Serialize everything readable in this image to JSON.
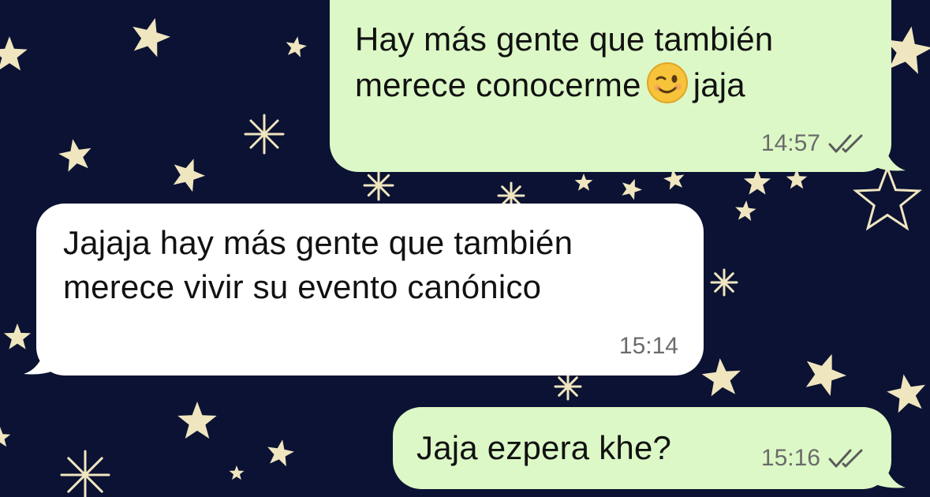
{
  "colors": {
    "wallpaper": "#0c1233",
    "star": "#efe6c0",
    "outgoing_bubble": "#dcf8c6",
    "incoming_bubble": "#ffffff",
    "timestamp": "#6b6b6b",
    "ticks": "#5b5b5b"
  },
  "messages": [
    {
      "direction": "outgoing",
      "line1": "Hay más gente que también",
      "line2_before": "merece conocerme",
      "emoji": "winking-face",
      "line2_after": "jaja",
      "time": "14:57",
      "status": "read-double-check"
    },
    {
      "direction": "incoming",
      "line1": "Jajaja hay más gente que también",
      "line2": "merece vivir su evento canónico",
      "time": "15:14"
    },
    {
      "direction": "outgoing",
      "line1": "Jaja ezpera khe?",
      "time": "15:16",
      "status": "read-double-check"
    }
  ]
}
